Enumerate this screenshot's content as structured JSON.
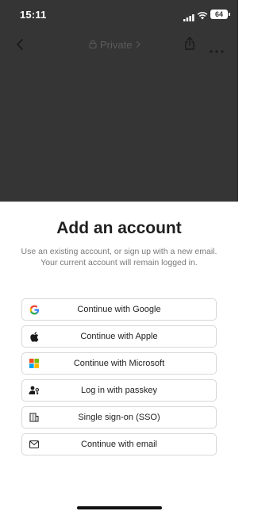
{
  "status_bar": {
    "time": "15:11",
    "battery": "64"
  },
  "nav": {
    "title": "Private",
    "icons": [
      "back-icon",
      "lock-icon",
      "chevron-right-icon",
      "share-icon",
      "more-icon"
    ]
  },
  "sheet": {
    "title": "Add an account",
    "subtitle_line1": "Use an existing account, or sign up with a new email.",
    "subtitle_line2": "Your current account will remain logged in.",
    "options": [
      {
        "label": "Continue with Google",
        "icon": "google-icon"
      },
      {
        "label": "Continue with Apple",
        "icon": "apple-icon"
      },
      {
        "label": "Continue with Microsoft",
        "icon": "microsoft-icon"
      },
      {
        "label": "Log in with passkey",
        "icon": "passkey-icon"
      },
      {
        "label": "Single sign-on (SSO)",
        "icon": "building-icon"
      },
      {
        "label": "Continue with email",
        "icon": "mail-icon"
      }
    ]
  },
  "colors": {
    "dim_overlay": "#353535",
    "sheet_bg": "#ffffff",
    "button_border": "#d8d8d8",
    "subtitle": "#7a7a7a"
  }
}
